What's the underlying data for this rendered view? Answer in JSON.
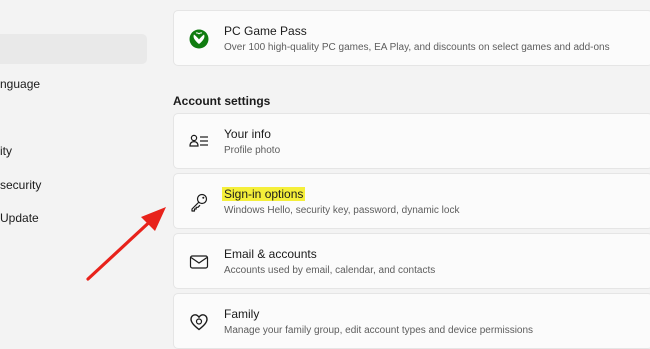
{
  "sidebar": {
    "items": [
      {
        "label": "nguage"
      },
      {
        "label": "ity"
      },
      {
        "label": "security"
      },
      {
        "label": "Update"
      }
    ]
  },
  "top_card": {
    "title": "PC Game Pass",
    "description": "Over 100 high-quality PC games, EA Play, and discounts on select games and add-ons",
    "icon": "xbox-icon",
    "icon_color": "#107c10"
  },
  "section": {
    "title": "Account settings"
  },
  "cards": [
    {
      "title": "Your info",
      "description": "Profile photo",
      "icon": "person-info-icon"
    },
    {
      "title": "Sign-in options",
      "description": "Windows Hello, security key, password, dynamic lock",
      "icon": "key-icon"
    },
    {
      "title": "Email & accounts",
      "description": "Accounts used by email, calendar, and contacts",
      "icon": "mail-icon"
    },
    {
      "title": "Family",
      "description": "Manage your family group, edit account types and device permissions",
      "icon": "family-heart-icon"
    }
  ],
  "colors": {
    "highlight": "#f5ef3a",
    "arrow": "#e8221b"
  }
}
